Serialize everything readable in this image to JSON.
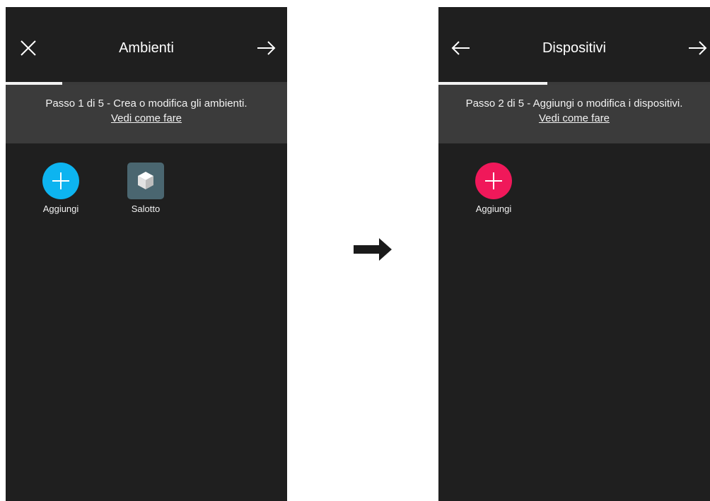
{
  "screens": [
    {
      "title": "Ambienti",
      "left_nav_icon": "close-icon",
      "right_nav_icon": "arrow-right-icon",
      "progress": 0.2,
      "step_text": "Passo 1 di 5 - Crea o modifica gli ambienti.",
      "help_link": "Vedi come fare",
      "tiles": [
        {
          "label": "Aggiungi",
          "icon": "add-circle-icon",
          "color": "#0db4f0"
        },
        {
          "label": "Salotto",
          "icon": "room-cube-icon",
          "color": "#4a6670"
        }
      ]
    },
    {
      "title": "Dispositivi",
      "left_nav_icon": "arrow-left-icon",
      "right_nav_icon": "arrow-right-icon",
      "progress": 0.4,
      "step_text": "Passo 2 di 5 - Aggiungi o modifica i dispositivi.",
      "help_link": "Vedi come fare",
      "tiles": [
        {
          "label": "Aggiungi",
          "icon": "add-circle-icon",
          "color": "#f0185a"
        }
      ]
    }
  ],
  "transition_icon": "right-arrow-icon",
  "colors": {
    "background": "#1f1f1f",
    "banner": "#3b3b3b",
    "text": "#f2f2f2"
  }
}
